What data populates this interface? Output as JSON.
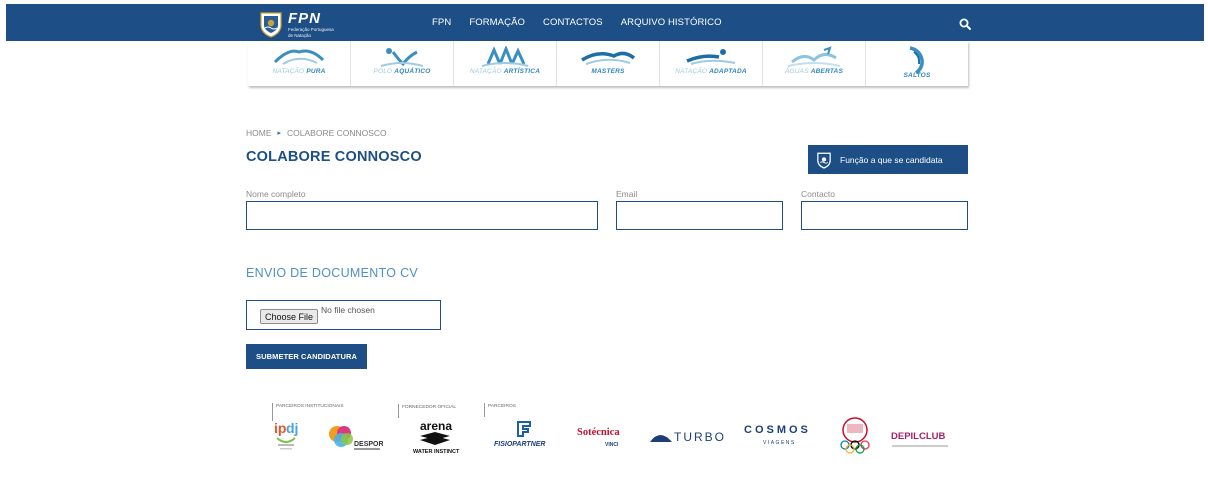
{
  "header": {
    "logo_name": "FPN",
    "logo_sub_line1": "Federação Portuguesa",
    "logo_sub_line2": "de Natação",
    "nav": [
      "FPN",
      "FORMAÇÃO",
      "CONTACTOS",
      "ARQUIVO HISTÓRICO"
    ],
    "search_icon": "search-icon",
    "bar_color": "#1d4f86"
  },
  "disciplines": [
    {
      "light": "NATAÇÃO ",
      "bold": "PURA"
    },
    {
      "light": "POLO ",
      "bold": "AQUÁTICO"
    },
    {
      "light": "NATAÇÃO ",
      "bold": "ARTÍSTICA"
    },
    {
      "light": "",
      "bold": "MASTERS"
    },
    {
      "light": "NATAÇÃO ",
      "bold": "ADAPTADA"
    },
    {
      "light": "ÁGUAS ",
      "bold": "ABERTAS"
    },
    {
      "light": "",
      "bold": "SALTOS"
    }
  ],
  "breadcrumb": {
    "home": "HOME",
    "separator": "▸",
    "current": "COLABORE CONNOSCO"
  },
  "page_title": "COLABORE CONNOSCO",
  "function_button": "Função a que se candidata",
  "form": {
    "name_label": "Nome completo",
    "name_value": "",
    "email_label": "Email",
    "email_value": "",
    "contact_label": "Contacto",
    "contact_value": ""
  },
  "cv_section": {
    "title": "ENVIO DE DOCUMENTO CV",
    "choose_file": "Choose File",
    "no_file": "No file chosen",
    "submit": "SUBMETER CANDIDATURA"
  },
  "partners": {
    "group_institutional": "PARCEIROS INSTITUCIONAIS",
    "group_supplier": "FORNECEDOR OFICIAL",
    "group_partners": "PARCEIROS",
    "arena": "arena",
    "arena_tag": "WATER INSTINCT",
    "fisio": "FISIOPARTNER",
    "sotecnica": "Sotécnica",
    "sotecnica_sub": "VINCI",
    "turbo": "TURBO",
    "cosmos": "COSMOS",
    "cosmos_sub": "VIAGENS",
    "depil": "DEPILCLUB",
    "desporto": "DESPORTO PARA TODOS"
  }
}
